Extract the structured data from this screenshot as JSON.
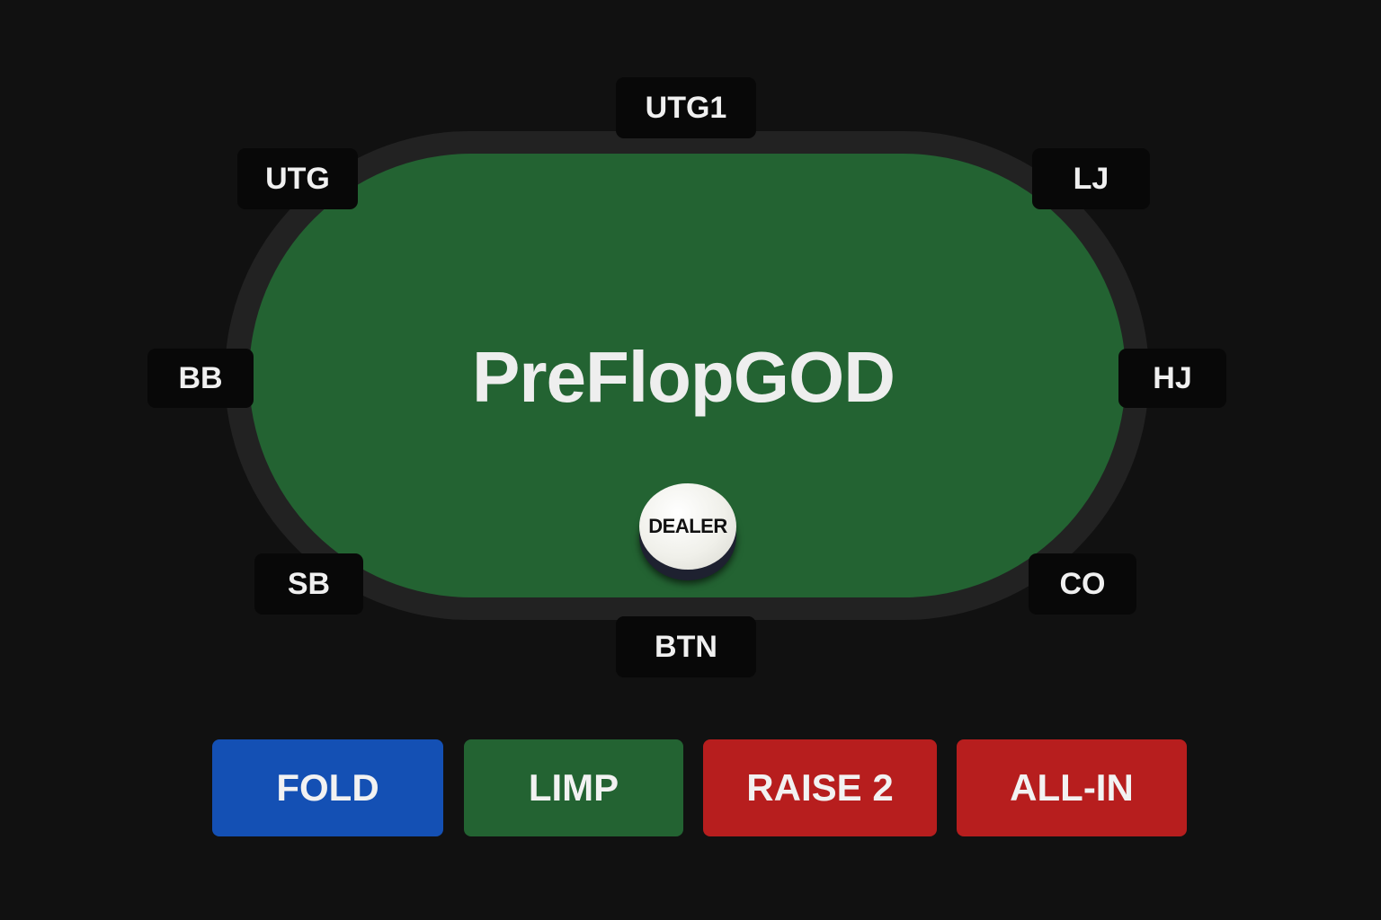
{
  "table": {
    "title": "PreFlopGOD"
  },
  "seats": {
    "utg1": "UTG1",
    "utg": "UTG",
    "lj": "LJ",
    "bb": "BB",
    "hj": "HJ",
    "sb": "SB",
    "co": "CO",
    "btn": "BTN"
  },
  "dealer": {
    "label": "DEALER"
  },
  "actions": {
    "fold": {
      "label": "FOLD",
      "color": "#1450b4"
    },
    "limp": {
      "label": "LIMP",
      "color": "#236332"
    },
    "raise": {
      "label": "RAISE 2",
      "color": "#b71e1e"
    },
    "allin": {
      "label": "ALL-IN",
      "color": "#b71e1e"
    }
  },
  "colors": {
    "background": "#111111",
    "rail": "#222222",
    "felt": "#236332",
    "seat": "#080808"
  }
}
